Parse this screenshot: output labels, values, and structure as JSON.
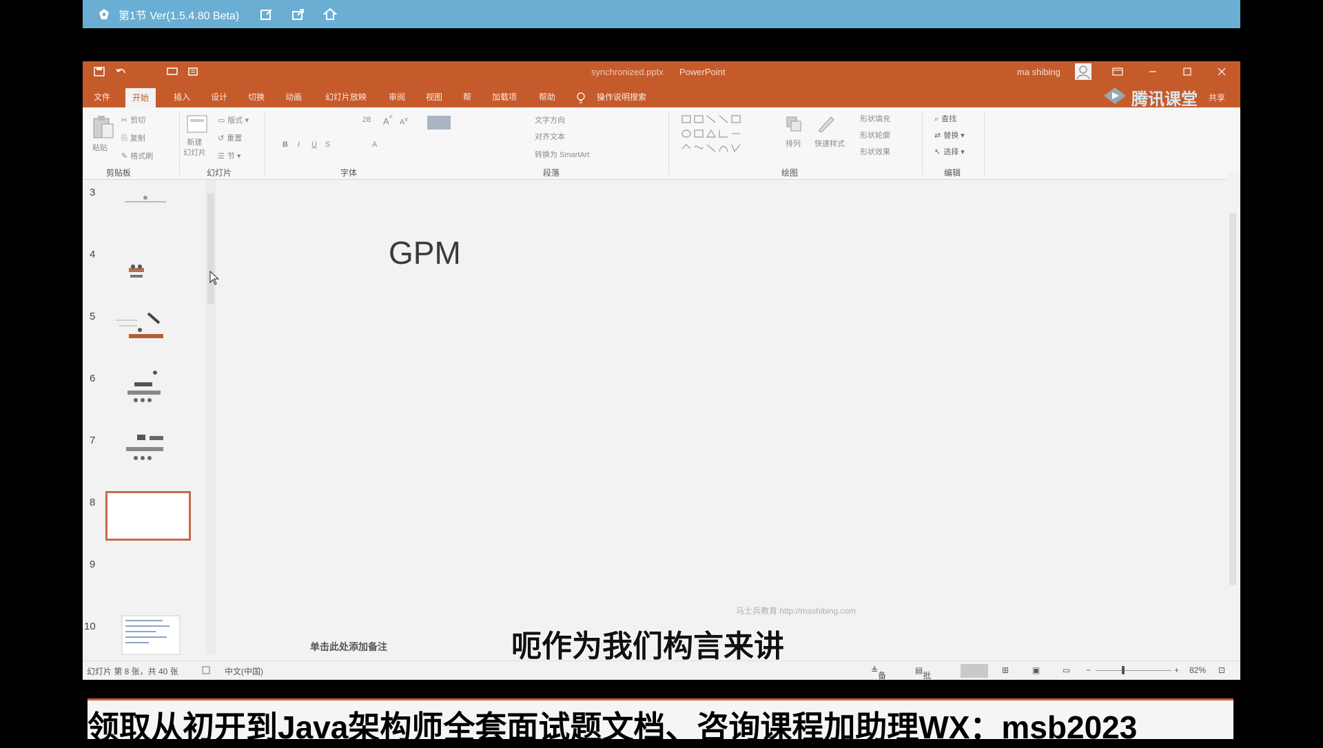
{
  "app": {
    "topbar_title": "第1节 Ver(1.5.4.80 Beta)",
    "accent": "#6aaed3"
  },
  "window": {
    "filename": "synchronized.pptx",
    "app_name": "PowerPoint",
    "user": "ma shibing",
    "brand_overlay": "腾讯课堂",
    "share_label": "共享",
    "title_color": "#c55a2b"
  },
  "tabs": [
    "文件",
    "开始",
    "插入",
    "设计",
    "切换",
    "动画",
    "幻灯片放映",
    "审阅",
    "视图",
    "帮",
    "加载项",
    "帮助",
    "操作说明搜索"
  ],
  "ribbon": {
    "clipboard": {
      "paste": "粘贴",
      "cut": "剪切",
      "copy": "复制",
      "format_painter": "格式刷",
      "label": "剪贴板"
    },
    "slides": {
      "new_slide": "新建\n幻灯片",
      "layout": "版式",
      "reset": "重置",
      "section": "节",
      "label": "幻灯片"
    },
    "font": {
      "size": "28",
      "label": "字体",
      "bold": "B",
      "italic": "I",
      "underline": "U",
      "strike": "S",
      "font_a": "A"
    },
    "paragraph": {
      "text_direction": "文字方向",
      "align_text": "对齐文本",
      "smartart": "转换为 SmartArt",
      "label": "段落"
    },
    "drawing": {
      "arrange": "排列",
      "quick_styles": "快速样式",
      "shape_fill": "形状填充",
      "shape_outline": "形状轮廓",
      "shape_effects": "形状效果",
      "label": "绘图"
    },
    "editing": {
      "find": "查找",
      "replace": "替换",
      "select": "选择",
      "label": "编辑"
    }
  },
  "thumbnails": [
    {
      "num": "3"
    },
    {
      "num": "4"
    },
    {
      "num": "5"
    },
    {
      "num": "6"
    },
    {
      "num": "7"
    },
    {
      "num": "8",
      "selected": true
    },
    {
      "num": "9"
    },
    {
      "num": "10"
    }
  ],
  "slide": {
    "title": "GPM",
    "footer_watermark": "马士兵教育 http://mashibing.com"
  },
  "notes_hint": "单击此处添加备注",
  "subtitle": "呃作为我们构言来讲",
  "status": {
    "slide_info": "幻灯片 第 8 张，共 40 张",
    "language": "中文(中国)",
    "notes": "备注",
    "comments": "批注",
    "zoom": "82%"
  },
  "banner": {
    "text": "领取从初开到Java架构师全套面试题文档、咨询课程加助理WX：msb2023",
    "line_color": "#d45b2b"
  }
}
